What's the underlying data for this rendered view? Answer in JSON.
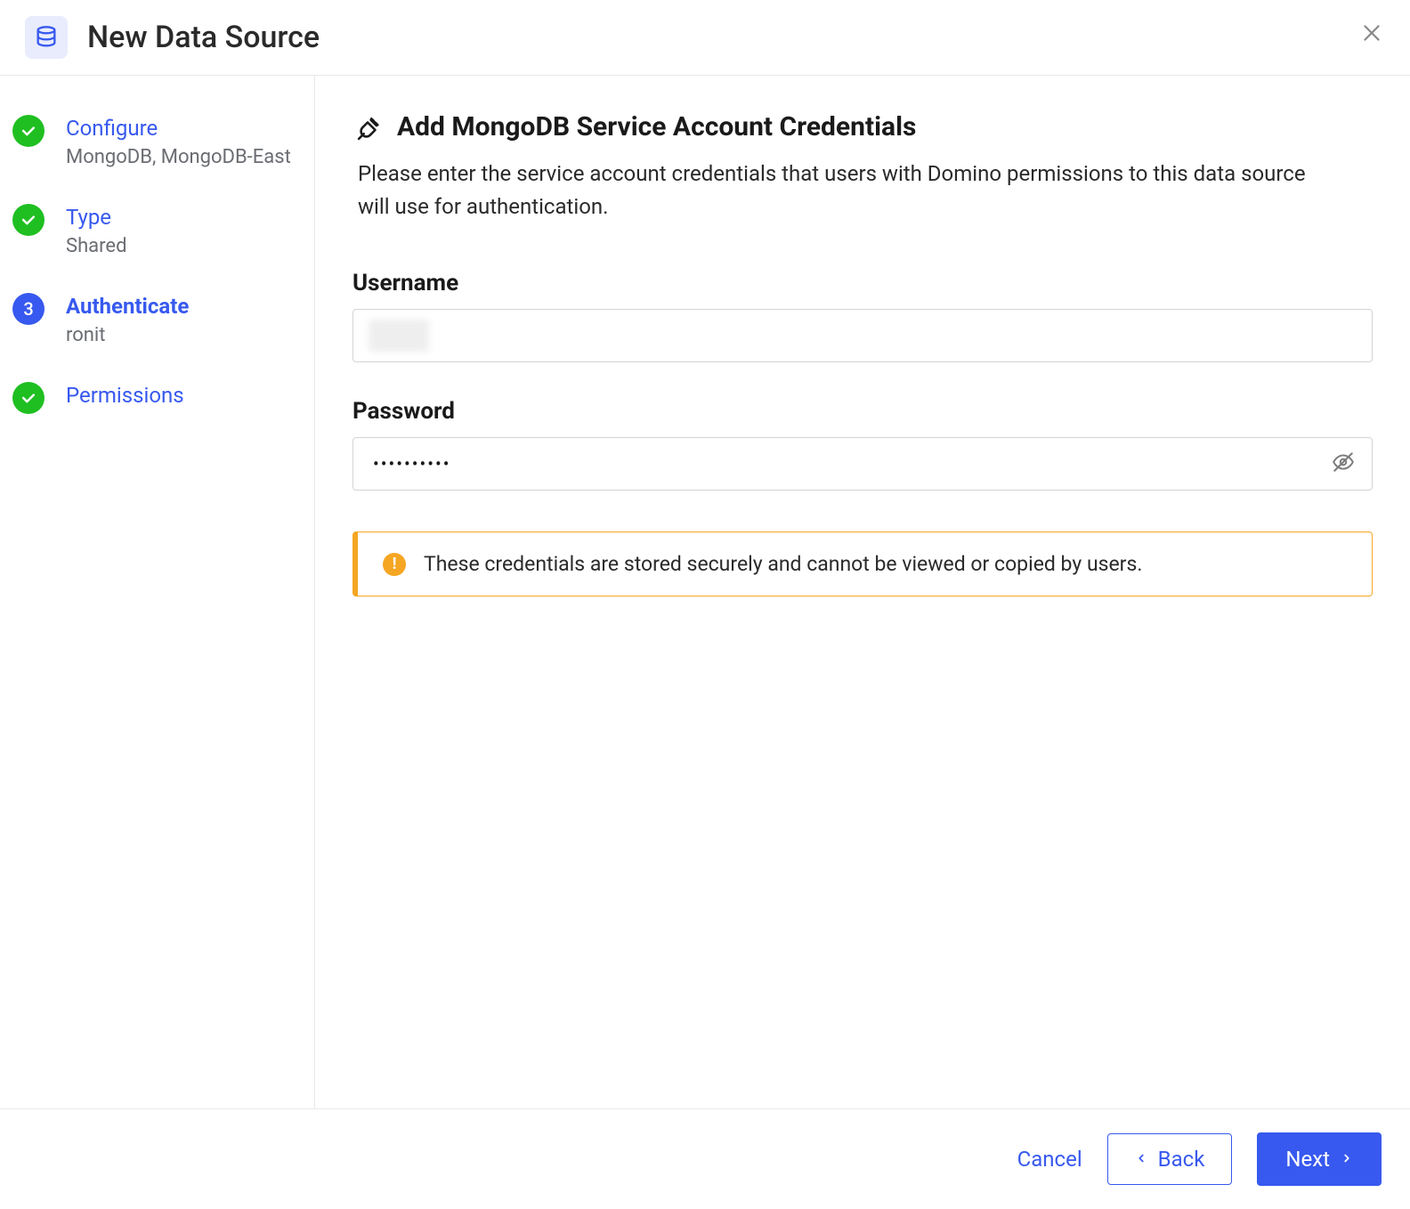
{
  "header": {
    "title": "New Data Source"
  },
  "sidebar": {
    "steps": [
      {
        "title": "Configure",
        "sub": "MongoDB, MongoDB-East",
        "status": "done"
      },
      {
        "title": "Type",
        "sub": "Shared",
        "status": "done"
      },
      {
        "title": "Authenticate",
        "sub": "ronit",
        "status": "active",
        "number": "3"
      },
      {
        "title": "Permissions",
        "sub": "",
        "status": "done"
      }
    ]
  },
  "main": {
    "title": "Add MongoDB Service Account Credentials",
    "description": "Please enter the service account credentials that users with Domino permissions to this data source will use for authentication.",
    "username_label": "Username",
    "username_value": "",
    "password_label": "Password",
    "password_value": "••••••••••",
    "alert_text": "These credentials are stored securely and cannot be viewed or copied by users."
  },
  "footer": {
    "cancel": "Cancel",
    "back": "Back",
    "next": "Next"
  }
}
